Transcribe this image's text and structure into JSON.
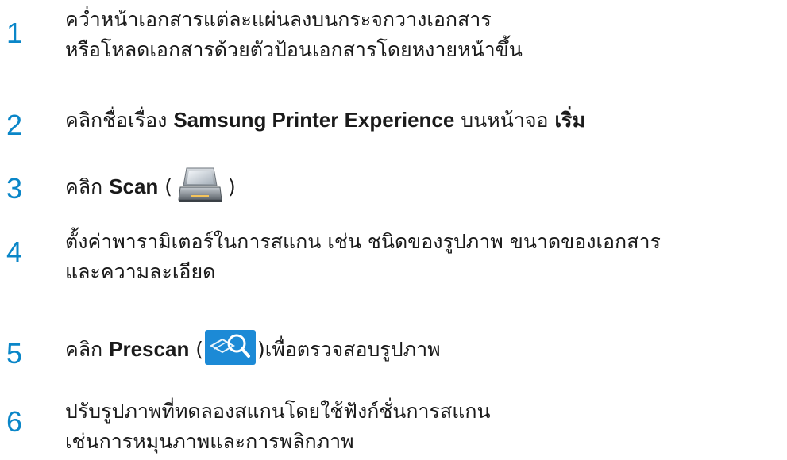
{
  "steps": [
    {
      "number": "1",
      "lines": [
        "คว่ำหน้าเอกสารแต่ละแผ่นลงบนกระจกวางเอกสาร",
        "หรือโหลดเอกสารด้วยตัวป้อนเอกสารโดยหงายหน้าขึ้น"
      ]
    },
    {
      "number": "2",
      "prefix": "คลิกชื่อเรื่อง ",
      "keyword": "Samsung Printer Experience",
      "middle": " บนหน้าจอ ",
      "bold_word": "เริ่ม"
    },
    {
      "number": "3",
      "prefix": "คลิก ",
      "keyword": "Scan",
      "open_paren": " (",
      "icon": "scanner-icon",
      "close_paren": ")"
    },
    {
      "number": "4",
      "lines": [
        "ตั้งค่าพารามิเตอร์ในการสแกน เช่น ชนิดของรูปภาพ ขนาดของเอกสาร",
        "และความละเอียด"
      ]
    },
    {
      "number": "5",
      "prefix": "คลิก ",
      "keyword": "Prescan",
      "open_paren": " (",
      "icon": "prescan-magnifier-icon",
      "close_paren": ")",
      "suffix": "เพื่อตรวจสอบรูปภาพ"
    },
    {
      "number": "6",
      "lines": [
        "ปรับรูปภาพที่ทดลองสแกนโดยใช้ฟังก์ชั่นการสแกน",
        "เช่นการหมุนภาพและการพลิกภาพ"
      ]
    }
  ],
  "colors": {
    "step_number": "#0a86c8",
    "text": "#1a1a1a",
    "prescan_icon_bg": "#1c8ad6"
  }
}
